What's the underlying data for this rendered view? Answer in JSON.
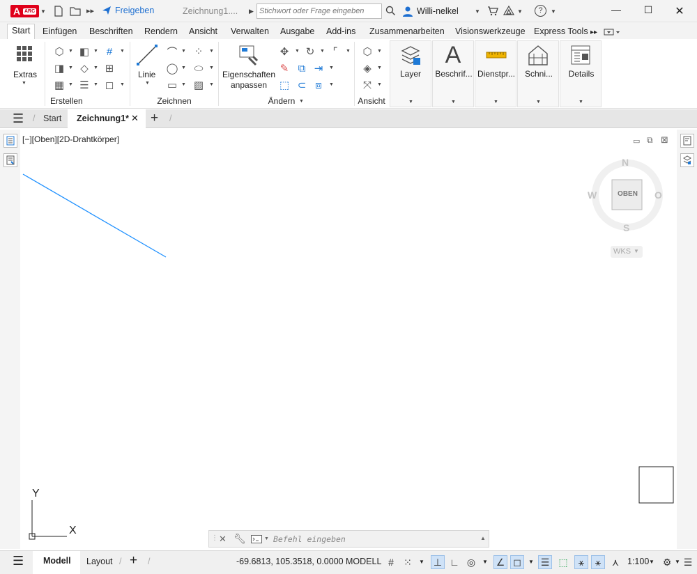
{
  "titlebar": {
    "app_logo_letter": "A",
    "app_logo_badge": "ARC",
    "share_label": "Freigeben",
    "doc_title": "Zeichnung1....",
    "search_placeholder": "Stichwort oder Frage eingeben",
    "user_name": "Willi-nelkel",
    "help_glyph": "?"
  },
  "ribbon_tabs": [
    "Start",
    "Einfügen",
    "Beschriften",
    "Rendern",
    "Ansicht",
    "Verwalten",
    "Ausgabe",
    "Add-ins",
    "Zusammenarbeiten",
    "Visionswerkzeuge",
    "Express Tools"
  ],
  "ribbon": {
    "extras_label": "Extras",
    "group_erstellen": "Erstellen",
    "linie_label": "Linie",
    "group_zeichnen": "Zeichnen",
    "eigenschaften_line1": "Eigenschaften",
    "eigenschaften_line2": "anpassen",
    "group_aendern": "Ändern",
    "group_ansicht": "Ansicht",
    "layer_label": "Layer",
    "beschrif_label": "Beschrif...",
    "dienstpr_label": "Dienstpr...",
    "schni_label": "Schni...",
    "details_label": "Details"
  },
  "file_tabs": {
    "start": "Start",
    "active": "Zeichnung1*"
  },
  "viewport": {
    "label": "[−][Oben][2D-Drahtkörper]",
    "compass_n": "N",
    "compass_s": "S",
    "compass_w": "W",
    "compass_o": "O",
    "cube_face": "OBEN",
    "wcs_label": "WKS",
    "axis_x": "X",
    "axis_y": "Y"
  },
  "command": {
    "placeholder": "Befehl eingeben"
  },
  "statusbar": {
    "modell_tab": "Modell",
    "layout_tab": "Layout",
    "coords": "-69.6813, 105.3518, 0.0000",
    "modell_btn": "MODELL",
    "scale": "1:100"
  },
  "colors": {
    "accent": "#1f7ad6",
    "logo": "#e0001a",
    "drawn_line": "#1e90ff"
  }
}
